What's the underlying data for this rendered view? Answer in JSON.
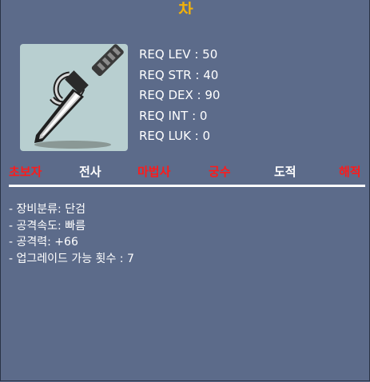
{
  "item": {
    "name": "차",
    "icon": "dagger-icon"
  },
  "requirements": [
    {
      "label": "REQ LEV",
      "value": "50"
    },
    {
      "label": "REQ STR",
      "value": "40"
    },
    {
      "label": "REQ DEX",
      "value": "90"
    },
    {
      "label": "REQ INT",
      "value": "0"
    },
    {
      "label": "REQ LUK",
      "value": "0"
    }
  ],
  "jobs": [
    {
      "label": "초보자",
      "usable": false
    },
    {
      "label": "전사",
      "usable": true
    },
    {
      "label": "마법사",
      "usable": false
    },
    {
      "label": "궁수",
      "usable": false
    },
    {
      "label": "도적",
      "usable": true
    },
    {
      "label": "해적",
      "usable": false
    }
  ],
  "description": [
    "- 장비분류: 단검",
    "- 공격속도: 빠름",
    "- 공격력: +66",
    "- 업그레이드 가능 횟수 : 7"
  ],
  "colors": {
    "background": "#5c6b8a",
    "title": "#f2b10a",
    "unusable_job": "#ff1a1a",
    "usable_job": "#ffffff",
    "icon_bg": "#b8cfd0"
  }
}
